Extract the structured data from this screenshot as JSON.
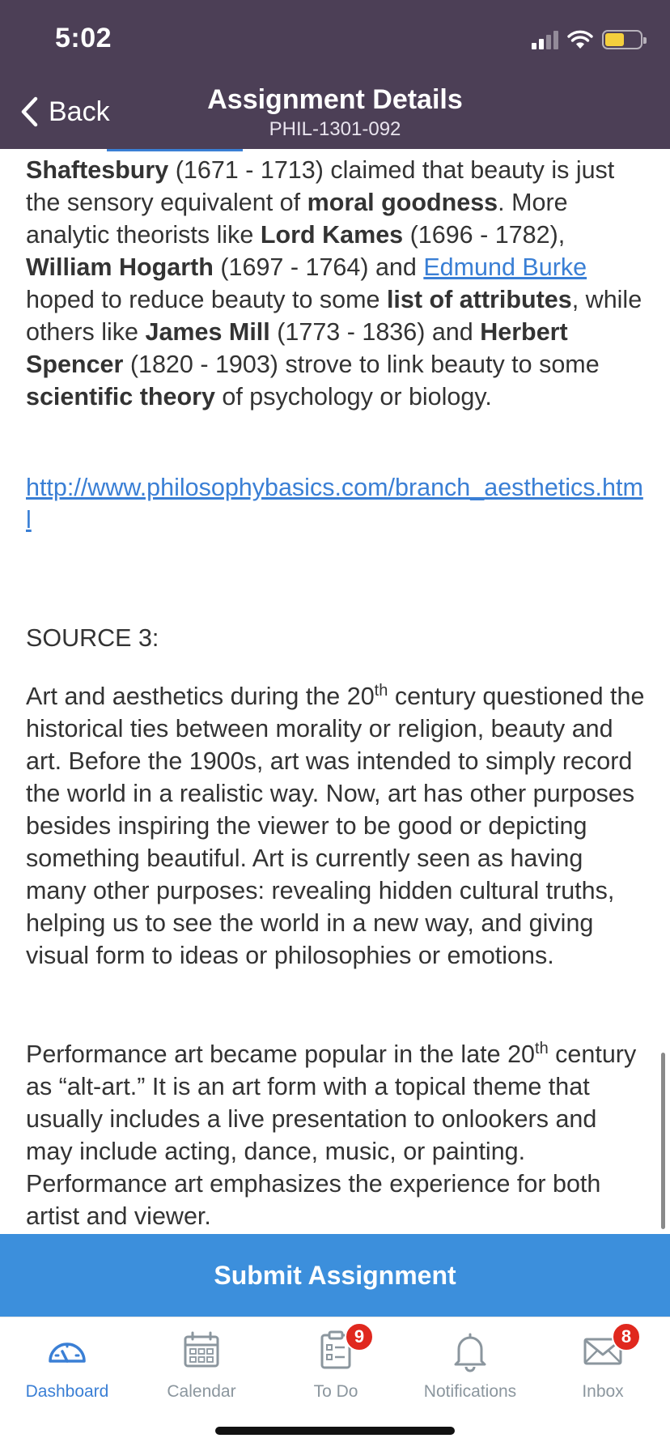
{
  "status_bar": {
    "time": "5:02",
    "battery_color": "#f4cf3d"
  },
  "header": {
    "back_label": "Back",
    "title": "Assignment Details",
    "subtitle": "PHIL-1301-092",
    "background_color": "#4c3f56"
  },
  "content": {
    "p1": {
      "shaftesbury": "Shaftesbury",
      "t1": " (1671 - 1713) claimed that beauty is just the sensory equivalent of ",
      "moral_goodness": "moral goodness",
      "t2": ". More analytic theorists like ",
      "lord_kames": "Lord Kames",
      "t3": " (1696 - 1782), ",
      "william_hogarth": "William Hogarth",
      "t4": " (1697 - 1764) and ",
      "edmund_burke_link": "Edmund Burke",
      "t5": " hoped to reduce beauty to some ",
      "list_of_attributes": "list of attributes",
      "t6": ", while others like ",
      "james_mill": "James Mill",
      "t7": " (1773 - 1836) and ",
      "herbert_spencer": "Herbert Spencer",
      "t8": " (1820 - 1903) strove to link beauty to some ",
      "scientific_theory": "scientific theory",
      "t9": " of psychology or biology."
    },
    "source_link": "http://www.philosophybasics.com/branch_aesthetics.html",
    "source_heading": "SOURCE 3:",
    "p3": {
      "t1": "Art and aesthetics during the 20",
      "sup": "th",
      "t2": " century questioned the historical ties between morality or religion, beauty and art.  Before the 1900s, art was intended to simply record the world in a realistic way. Now, art has other purposes besides inspiring the viewer to be good or depicting something beautiful.  Art is currently seen as having many other purposes: revealing hidden cultural truths, helping us to see the world in a new way, and giving visual form to ideas or philosophies or emotions."
    },
    "p4": {
      "t1": "Performance art became popular in the late 20",
      "sup": "th",
      "t2": " century as “alt-art.”  It is an art form with a topical theme that usually includes a live presentation to onlookers and may include acting, dance, music, or painting.  Performance art emphasizes the experience for both artist and viewer."
    },
    "link_color": "#3a7fd5"
  },
  "submit_button": {
    "label": "Submit Assignment",
    "color": "#3c8fdc"
  },
  "tab_bar": {
    "tabs": [
      {
        "label": "Dashboard",
        "icon": "dashboard-icon",
        "active": true
      },
      {
        "label": "Calendar",
        "icon": "calendar-icon",
        "active": false
      },
      {
        "label": "To Do",
        "icon": "todo-icon",
        "active": false,
        "badge": "9"
      },
      {
        "label": "Notifications",
        "icon": "bell-icon",
        "active": false
      },
      {
        "label": "Inbox",
        "icon": "mail-icon",
        "active": false,
        "badge": "8"
      }
    ],
    "active_color": "#3a7fd5",
    "badge_color": "#e0281e"
  }
}
